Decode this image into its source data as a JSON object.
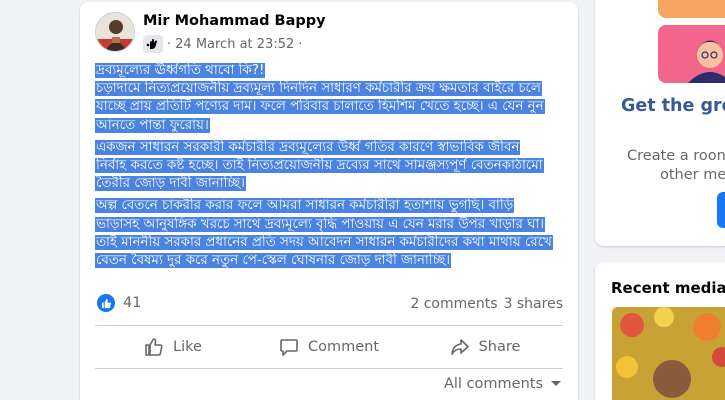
{
  "post": {
    "author": "Mir Mohammad Bappy",
    "audience_icon": "custom-audience-icon",
    "timestamp": "24 March at 23:52",
    "sep1": "·",
    "sep2": "·",
    "paragraphs": [
      [
        "দ্রব্যমূল্যের ঊর্ধ্বগতি থাবো কি?!",
        "চড়াদামে নিত্যপ্রয়োজনীয় দ্রব্যমূল্য দিনদিন সাধারণ কর্মচারীর ক্রয় ক্ষমতার বাইরে চলে",
        "যাচ্ছে প্রায় প্রতিটি পণ্যের দাম। ফলে পরিবার চালাতে হিমশিম খেতে হচ্ছে। এ যেন নুন",
        "আনতে পান্তা ফুরোয়।"
      ],
      [
        "একজন সাধারন সরকারী কর্মচারীর দ্রব্যমূল্যের উর্ধ্ব গতির কারণে স্বাভাবিক জীবন",
        "নির্বাহ করতে কষ্ট হচ্ছে। তাই নিত্যপ্রয়োজনীয় দ্রব্যের সাথে সামঞ্জস্যপূর্ণ বেতনকাঠামো",
        "তৈরীর জোড় দাবী জানাচ্ছি।"
      ],
      [
        "অল্প বেতনে চাকরীর করার ফলে আমরা সাধারন কর্মচারীরা হতাশায় ভুগছি। বাড়ি",
        "ভাড়াসহ আনুষঙ্গিক খরচে সাথে দ্রব্যমূল্যে বৃদ্ধি পাওয়ায় এ যেন মরার উপর খাড়ার ঘা।",
        "তাই মাননীয় সরকার প্রধানের প্রতি সদয় আবেদন সাধারন কর্মচারীদের কথা মাথায় রেখে",
        "বেতন বৈষম্য দুর করে নতুন পে-স্কেল ঘোষনার জোড় দাবী জানাচ্ছি।"
      ]
    ],
    "reaction_icon": "like-icon",
    "reaction_count": "41",
    "comments_count": "2 comments",
    "shares_count": "3 shares",
    "actions": {
      "like": "Like",
      "comment": "Comment",
      "share": "Share"
    },
    "all_comments": "All comments"
  },
  "sidebar": {
    "group_title": "Get the gro",
    "room_line1": "Create a roon",
    "room_line2": "other me",
    "recent_media_title": "Recent media"
  },
  "colors": {
    "selection": "#4a84e0",
    "brand": "#1877f2",
    "secondary_text": "#65676b",
    "link_title": "#385898"
  }
}
